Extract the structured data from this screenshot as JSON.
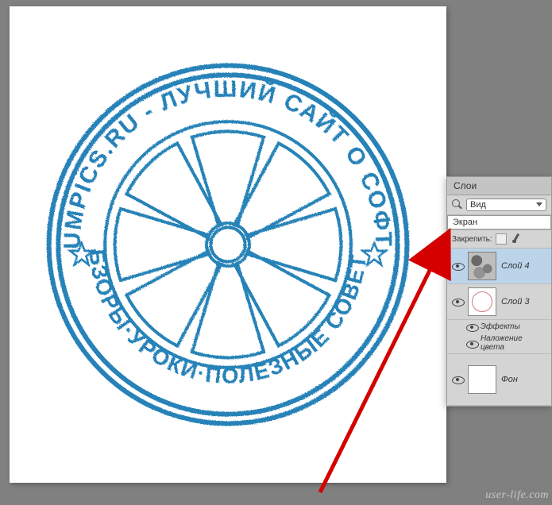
{
  "stamp": {
    "top_text": "LUMPICS.RU - ЛУЧШИЙ САЙТ О СОФТЕ",
    "bottom_text": "ОБЗОРЫ·УРОКИ·ПОЛЕЗНЫЕ СОВЕТЫ",
    "ink_color": "#3a86b8"
  },
  "panel": {
    "tab_label": "Слои",
    "filter_label": "Вид",
    "blend_mode": "Экран",
    "lock_label": "Закрепить:"
  },
  "layers": [
    {
      "name": "Слой 4",
      "visible": true,
      "selected": true,
      "thumb": "noise"
    },
    {
      "name": "Слой 3",
      "visible": true,
      "selected": false,
      "thumb": "stamp",
      "fx": {
        "label": "Эффекты",
        "items": [
          "Наложение цвета"
        ]
      }
    },
    {
      "name": "Фон",
      "visible": true,
      "selected": false,
      "thumb": "white"
    }
  ],
  "watermark": "user-life.com"
}
